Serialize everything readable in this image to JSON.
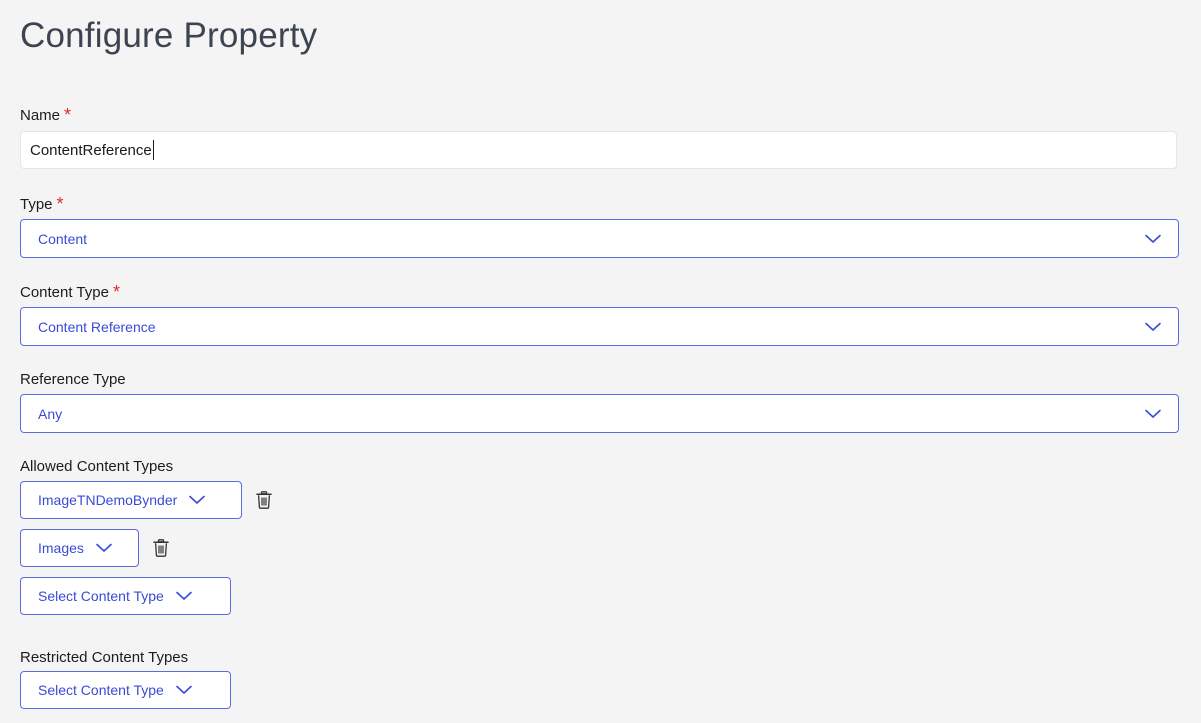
{
  "page": {
    "title": "Configure Property"
  },
  "name_field": {
    "label": "Name",
    "required_marker": "*",
    "value": "ContentReference"
  },
  "type_field": {
    "label": "Type",
    "required_marker": "*",
    "selected": "Content"
  },
  "content_type_field": {
    "label": "Content Type",
    "required_marker": "*",
    "selected": "Content Reference"
  },
  "reference_type_field": {
    "label": "Reference Type",
    "selected": "Any"
  },
  "allowed_content_types": {
    "label": "Allowed Content Types",
    "items": [
      {
        "selected": "ImageTNDemoBynder"
      },
      {
        "selected": "Images"
      }
    ],
    "add_placeholder": "Select Content Type"
  },
  "restricted_content_types": {
    "label": "Restricted Content Types",
    "add_placeholder": "Select Content Type"
  },
  "colors": {
    "accent": "#3a4bd6",
    "border_accent": "#5b6be0",
    "required": "#e0292f",
    "background": "#f4f4f4"
  },
  "icons": {
    "dropdown": "chevron-down-icon",
    "delete": "trash-icon"
  }
}
